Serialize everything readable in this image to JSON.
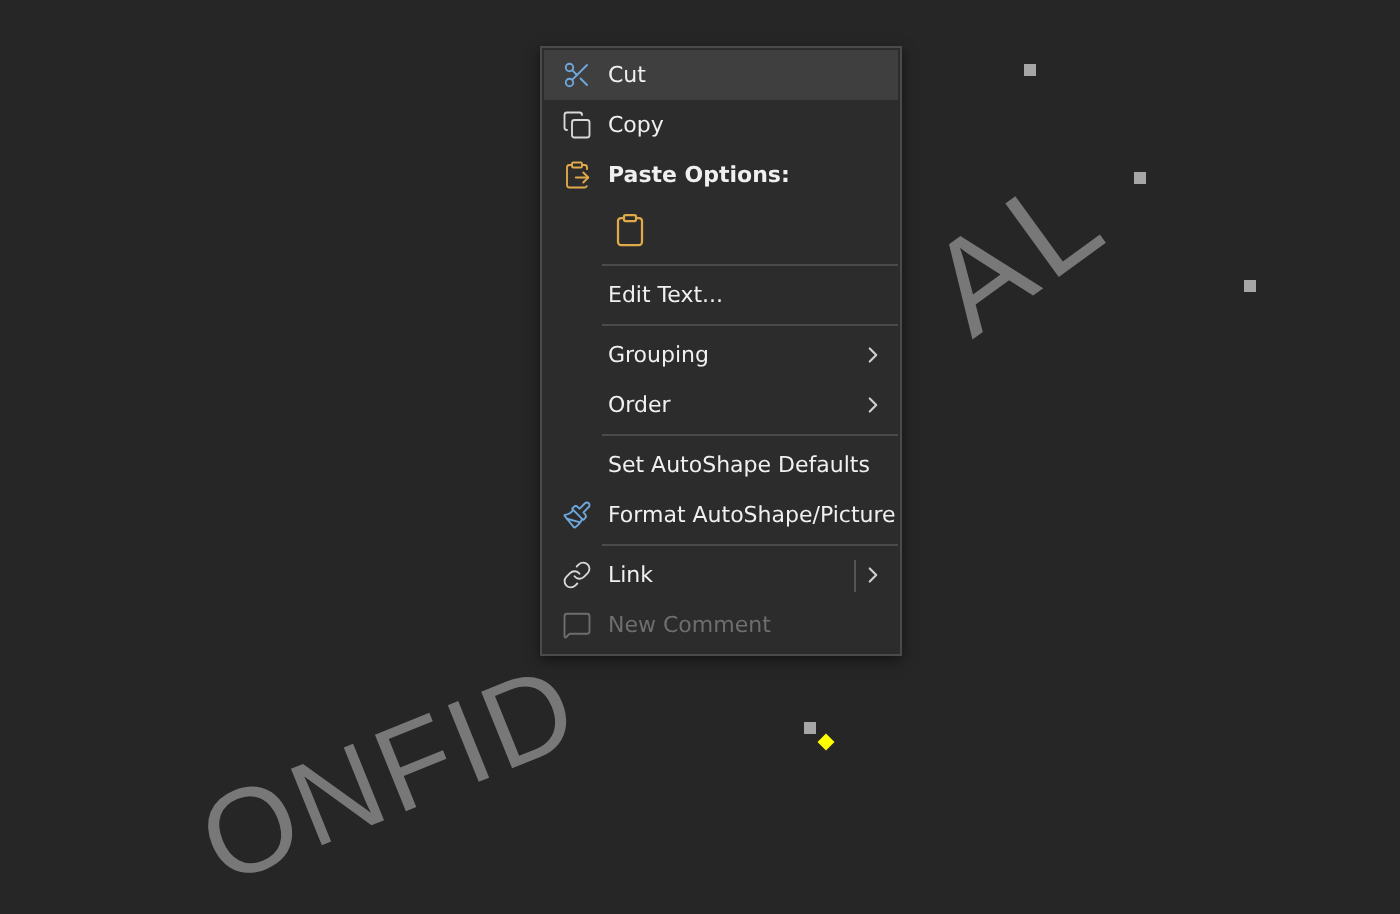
{
  "wordart": [
    {
      "text": "ONFID"
    },
    {
      "text": "AL"
    }
  ],
  "context_menu": {
    "items": [
      {
        "kind": "command",
        "label": "Cut",
        "hovered": true,
        "disabled": false
      },
      {
        "kind": "command",
        "label": "Copy",
        "hovered": false,
        "disabled": false
      },
      {
        "kind": "header",
        "label": "Paste Options:"
      },
      {
        "kind": "paste"
      },
      {
        "kind": "separator"
      },
      {
        "kind": "command",
        "label": "Edit Text...",
        "hovered": false,
        "disabled": false
      },
      {
        "kind": "separator"
      },
      {
        "kind": "submenu",
        "label": "Grouping",
        "hovered": false,
        "disabled": false
      },
      {
        "kind": "submenu",
        "label": "Order",
        "hovered": false,
        "disabled": false
      },
      {
        "kind": "separator"
      },
      {
        "kind": "command",
        "label": "Set AutoShape Defaults",
        "hovered": false,
        "disabled": false
      },
      {
        "kind": "command",
        "label": "Format AutoShape/Picture",
        "hovered": false,
        "disabled": false
      },
      {
        "kind": "separator"
      },
      {
        "kind": "split",
        "label": "Link",
        "hovered": false,
        "disabled": false
      },
      {
        "kind": "command",
        "label": "New Comment",
        "hovered": false,
        "disabled": true
      }
    ]
  }
}
